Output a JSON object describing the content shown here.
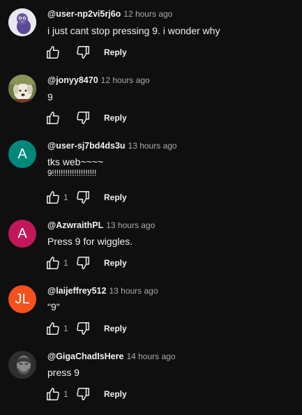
{
  "comments": [
    {
      "author": "@user-np2vi5rj6o",
      "time": "12 hours ago",
      "lines": [
        "i just cant stop pressing 9. i wonder why"
      ],
      "likes": "",
      "reply_label": "Reply",
      "avatar": {
        "type": "image",
        "name": "purple-bird-avatar",
        "bg": "#e9e9ef"
      }
    },
    {
      "author": "@jonyy8470",
      "time": "12 hours ago",
      "lines": [
        "9"
      ],
      "likes": "",
      "reply_label": "Reply",
      "avatar": {
        "type": "image",
        "name": "dog-avatar",
        "bg": "#5a6b3d"
      }
    },
    {
      "author": "@user-sj7bd4ds3u",
      "time": "13 hours ago",
      "lines": [
        "tks web~~~~",
        "9!!!!!!!!!!!!!!!!!!!!"
      ],
      "likes": "1",
      "reply_label": "Reply",
      "avatar": {
        "type": "letter",
        "letter": "A",
        "bg": "#00897b"
      }
    },
    {
      "author": "@AzwraithPL",
      "time": "13 hours ago",
      "lines": [
        "Press 9 for wiggles."
      ],
      "likes": "1",
      "reply_label": "Reply",
      "avatar": {
        "type": "letter",
        "letter": "A",
        "bg": "#c2185b"
      }
    },
    {
      "author": "@laijeffrey512",
      "time": "13 hours ago",
      "lines": [
        "\"9\""
      ],
      "likes": "1",
      "reply_label": "Reply",
      "avatar": {
        "type": "letter",
        "letter": "JL",
        "bg": "#f4511e"
      }
    },
    {
      "author": "@GigaChadIsHere",
      "time": "14 hours ago",
      "lines": [
        "press 9"
      ],
      "likes": "1",
      "reply_label": "Reply",
      "avatar": {
        "type": "image",
        "name": "gigachad-avatar",
        "bg": "#3a3a3a"
      }
    }
  ]
}
